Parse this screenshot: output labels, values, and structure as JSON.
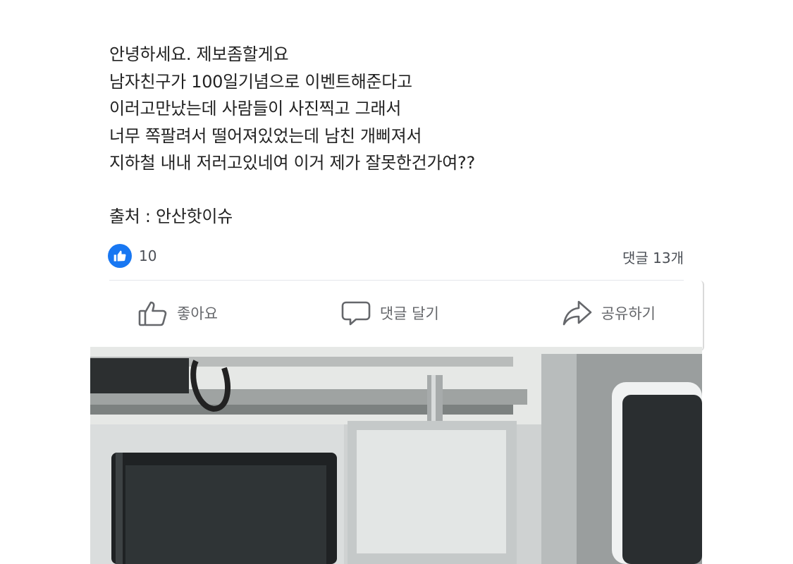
{
  "post": {
    "lines": [
      "안녕하세요. 제보좀할게요",
      "남자친구가 100일기념으로 이벤트해준다고",
      "이러고만났는데 사람들이 사진찍고 그래서",
      "너무 쪽팔려서 떨어져있었는데 남친 개삐져서",
      "지하철 내내 저러고있네여 이거 제가 잘못한건가여??"
    ],
    "source": "출처 : 안산핫이슈"
  },
  "reactions": {
    "like_count": "10",
    "comment_count": "댓글 13개"
  },
  "actions": {
    "like_label": "좋아요",
    "comment_label": "댓글 달기",
    "share_label": "공유하기"
  },
  "colors": {
    "like_blue": "#1877f2",
    "action_gray": "#65676b",
    "text": "#222222"
  },
  "icons": [
    "like-badge-icon",
    "thumbs-up-icon",
    "comment-icon",
    "share-icon"
  ],
  "photo": {
    "subject": "subway train interior"
  }
}
